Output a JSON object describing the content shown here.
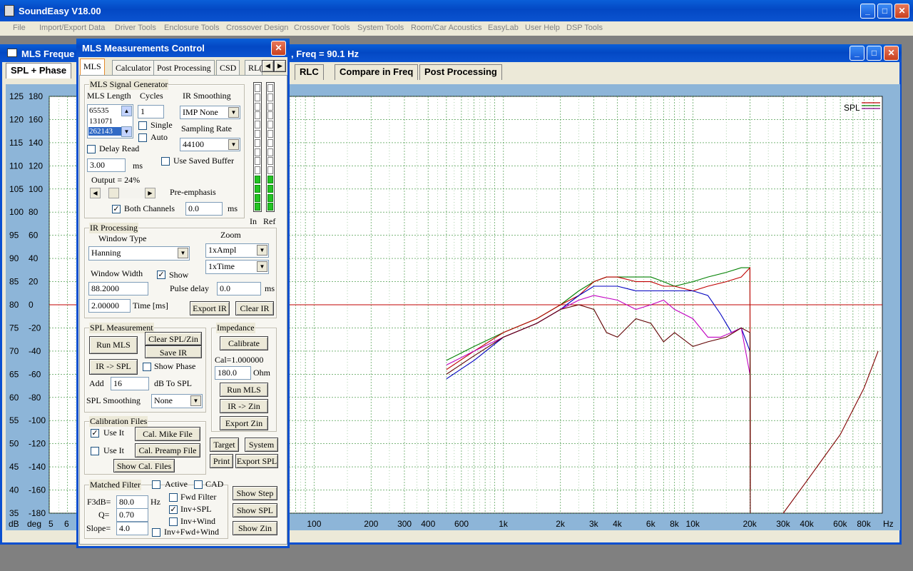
{
  "app": {
    "title": "SoundEasy V18.00"
  },
  "menu": [
    "File",
    "Import/Export Data",
    "Driver Tools",
    "Enclosure Tools",
    "Crossover Design",
    "Crossover Tools",
    "System Tools",
    "Room/Car Acoustics",
    "EasyLab",
    "User Help",
    "DSP Tools"
  ],
  "mls_window": {
    "title_left": "MLS Freque",
    "title_right": ", Freq = 90.1 Hz",
    "tabs": [
      "SPL + Phase",
      "RLC",
      "Compare in Freq",
      "Post Processing"
    ]
  },
  "chart_data": {
    "type": "line",
    "xscale": "log",
    "xlim": [
      4,
      100000
    ],
    "xticks": [
      "5",
      "6",
      "100",
      "200",
      "300",
      "400",
      "600",
      "1k",
      "2k",
      "3k",
      "4k",
      "6k",
      "8k",
      "10k",
      "20k",
      "30k",
      "40k",
      "60k",
      "80k",
      "Hz"
    ],
    "xunit_left": "dB",
    "xunit_left2": "deg",
    "y_db_ticks": [
      "125",
      "120",
      "115",
      "110",
      "105",
      "100",
      "95",
      "90",
      "85",
      "80",
      "75",
      "70",
      "65",
      "60",
      "55",
      "50",
      "45",
      "40",
      "35"
    ],
    "y_deg_ticks": [
      "180",
      "160",
      "140",
      "120",
      "100",
      "80",
      "60",
      "40",
      "20",
      "0",
      "-20",
      "-40",
      "-60",
      "-80",
      "-100",
      "-120",
      "-140",
      "-160",
      "-180"
    ],
    "ylim_db": [
      35,
      125
    ],
    "reference_db": 80,
    "legend": "SPL",
    "legend_colors": [
      "#c00000",
      "#008000",
      "#800080"
    ],
    "series": [
      {
        "color": "#008000",
        "x": [
          500,
          700,
          1000,
          1500,
          2000,
          2500,
          3000,
          3500,
          4000,
          5000,
          6000,
          7000,
          8000,
          10000,
          12000,
          15000,
          18000,
          20000,
          20100
        ],
        "y": [
          68,
          71,
          74,
          77,
          80,
          83,
          85,
          86,
          86,
          86,
          86,
          85,
          84,
          85,
          86,
          87,
          88,
          88,
          40
        ]
      },
      {
        "color": "#c00000",
        "x": [
          500,
          700,
          1000,
          1500,
          2000,
          2500,
          3000,
          3500,
          4000,
          5000,
          6000,
          7000,
          8000,
          10000,
          12000,
          15000,
          18000,
          20000,
          20100
        ],
        "y": [
          66,
          70,
          74,
          77,
          80,
          82,
          85,
          86,
          86,
          85,
          85,
          84,
          84,
          83,
          84,
          85,
          86,
          88,
          40
        ]
      },
      {
        "color": "#0000c0",
        "x": [
          500,
          700,
          1000,
          1500,
          2000,
          2500,
          3000,
          3500,
          4000,
          5000,
          6000,
          7000,
          8000,
          10000,
          12000,
          14000,
          16000,
          18000,
          20000
        ],
        "y": [
          64,
          68,
          73,
          76,
          79,
          82,
          84,
          84,
          84,
          83,
          83,
          83,
          83,
          83,
          82,
          78,
          74,
          75,
          70
        ]
      },
      {
        "color": "#c000c0",
        "x": [
          500,
          700,
          1000,
          1500,
          2000,
          2500,
          3000,
          4000,
          5000,
          6000,
          7000,
          8000,
          10000,
          12000,
          14000,
          16000,
          18000,
          20000
        ],
        "y": [
          67,
          70,
          73,
          76,
          79,
          81,
          82,
          81,
          79,
          80,
          81,
          79,
          77,
          73,
          73,
          74,
          75,
          65
        ]
      },
      {
        "color": "#600000",
        "x": [
          500,
          700,
          1000,
          1500,
          2000,
          2500,
          3000,
          3500,
          4000,
          5000,
          6000,
          7000,
          8000,
          10000,
          12000,
          15000,
          18000,
          20000,
          20100
        ],
        "y": [
          65,
          69,
          73,
          76,
          79,
          80,
          79,
          74,
          73,
          77,
          76,
          72,
          74,
          71,
          72,
          73,
          75,
          74,
          35
        ]
      },
      {
        "color": "#800000",
        "x": [
          30000,
          40000,
          60000,
          80000,
          95000
        ],
        "y": [
          35,
          42,
          52,
          62,
          70
        ]
      }
    ]
  },
  "dialog": {
    "title": "MLS Measurements Control",
    "tabs": [
      "MLS",
      "Calculator",
      "Post Processing",
      "CSD",
      "RL("
    ],
    "signal_generator": {
      "group": "MLS Signal Generator",
      "mls_length_label": "MLS Length",
      "cycles_label": "Cycles",
      "ir_smoothing_label": "IR Smoothing",
      "mls_options": [
        "65535",
        "131071",
        "262143"
      ],
      "cycles": "1",
      "ir_smoothing": "IMP None",
      "single_label": "Single",
      "auto_label": "Auto",
      "sampling_rate_label": "Sampling Rate",
      "sampling_rate": "44100",
      "delay_read_label": "Delay Read",
      "delay_ms": "3.00",
      "ms": "ms",
      "use_saved_buffer_label": "Use Saved Buffer",
      "output_label": "Output = 24%",
      "output_level": 0.24,
      "pre_emphasis_label": "Pre-emphasis",
      "both_channels_label": "Both Channels",
      "both_channels_value": "0.0",
      "meter_in_label": "In",
      "meter_ref_label": "Ref",
      "meter_in_level": 0.25,
      "meter_ref_level": 0.25
    },
    "ir_processing": {
      "group": "IR Processing",
      "window_type_label": "Window Type",
      "window_type": "Hanning",
      "zoom_label": "Zoom",
      "zoom_ampl": "1xAmpl",
      "zoom_time": "1xTime",
      "window_width_label": "Window Width",
      "show_label": "Show",
      "window_width": "88.2000",
      "pulse_delay_label": "Pulse delay",
      "pulse_delay": "0.0",
      "ms": "ms",
      "time_value": "2.00000",
      "time_label": "Time [ms]",
      "export_ir": "Export IR",
      "clear_ir": "Clear IR"
    },
    "spl": {
      "group": "SPL Measurement",
      "run_mls": "Run MLS",
      "clear_spl_zin": "Clear SPL/Zin",
      "save_ir": "Save IR",
      "ir_to_spl": "IR -> SPL",
      "show_phase": "Show Phase",
      "add_label": "Add",
      "add_value": "16",
      "db_to_spl": "dB   To SPL",
      "smoothing_label": "SPL Smoothing",
      "smoothing": "None"
    },
    "impedance": {
      "group": "Impedance",
      "calibrate": "Calibrate",
      "cal_text": "Cal=1.000000",
      "ohm_value": "180.0",
      "ohm": "Ohm",
      "run_mls": "Run MLS",
      "ir_to_zin": "IR -> Zin",
      "export_zin": "Export Zin"
    },
    "calibration": {
      "group": "Calibration Files",
      "use_it": "Use It",
      "cal_mike": "Cal. Mike File",
      "cal_preamp": "Cal. Preamp File",
      "show_cal": "Show Cal. Files"
    },
    "misc": {
      "target": "Target",
      "system": "System",
      "print": "Print",
      "export_spl": "Export SPL"
    },
    "matched_filter": {
      "group": "Matched Filter",
      "active": "Active",
      "cad": "CAD",
      "f3db_label": "F3dB=",
      "f3db": "80.0",
      "hz": "Hz",
      "q_label": "Q=",
      "q": "0.70",
      "slope_label": "Slope=",
      "slope": "4.0",
      "fwd_filter": "Fwd Filter",
      "inv_spl": "Inv+SPL",
      "inv_wind": "Inv+Wind",
      "inv_fwd_wind": "Inv+Fwd+Wind",
      "show_step": "Show Step",
      "show_spl": "Show SPL",
      "show_zin": "Show Zin"
    }
  }
}
